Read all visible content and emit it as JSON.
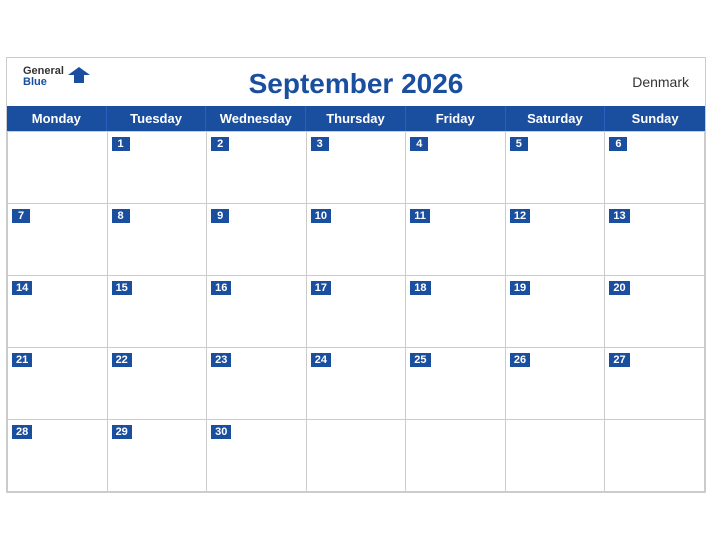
{
  "header": {
    "title": "September 2026",
    "country": "Denmark",
    "logo_general": "General",
    "logo_blue": "Blue"
  },
  "days_of_week": [
    "Monday",
    "Tuesday",
    "Wednesday",
    "Thursday",
    "Friday",
    "Saturday",
    "Sunday"
  ],
  "weeks": [
    [
      {
        "date": "",
        "empty": true
      },
      {
        "date": "1"
      },
      {
        "date": "2"
      },
      {
        "date": "3"
      },
      {
        "date": "4"
      },
      {
        "date": "5"
      },
      {
        "date": "6"
      }
    ],
    [
      {
        "date": "7"
      },
      {
        "date": "8"
      },
      {
        "date": "9"
      },
      {
        "date": "10"
      },
      {
        "date": "11"
      },
      {
        "date": "12"
      },
      {
        "date": "13"
      }
    ],
    [
      {
        "date": "14"
      },
      {
        "date": "15"
      },
      {
        "date": "16"
      },
      {
        "date": "17"
      },
      {
        "date": "18"
      },
      {
        "date": "19"
      },
      {
        "date": "20"
      }
    ],
    [
      {
        "date": "21"
      },
      {
        "date": "22"
      },
      {
        "date": "23"
      },
      {
        "date": "24"
      },
      {
        "date": "25"
      },
      {
        "date": "26"
      },
      {
        "date": "27"
      }
    ],
    [
      {
        "date": "28"
      },
      {
        "date": "29"
      },
      {
        "date": "30"
      },
      {
        "date": "",
        "empty": true
      },
      {
        "date": "",
        "empty": true
      },
      {
        "date": "",
        "empty": true
      },
      {
        "date": "",
        "empty": true
      }
    ]
  ]
}
